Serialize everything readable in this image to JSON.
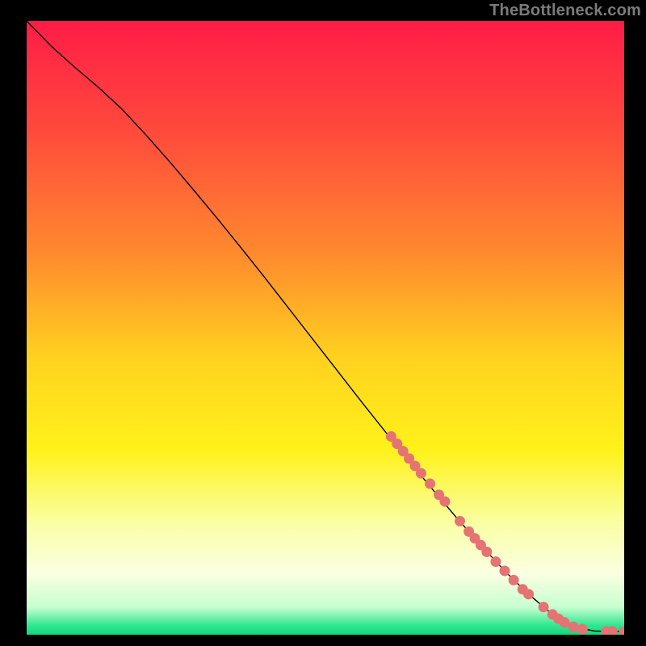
{
  "watermark": "TheBottleneck.com",
  "chart_data": {
    "type": "line",
    "title": "",
    "xlabel": "",
    "ylabel": "",
    "xlim": [
      0,
      100
    ],
    "ylim": [
      0,
      100
    ],
    "grid": false,
    "legend": false,
    "background_gradient": {
      "stops": [
        {
          "offset": 0.0,
          "color": "#ff1c47"
        },
        {
          "offset": 0.18,
          "color": "#ff4a3c"
        },
        {
          "offset": 0.38,
          "color": "#ff8a2e"
        },
        {
          "offset": 0.55,
          "color": "#ffd21f"
        },
        {
          "offset": 0.7,
          "color": "#fff21a"
        },
        {
          "offset": 0.82,
          "color": "#f9ffa6"
        },
        {
          "offset": 0.9,
          "color": "#fbffe2"
        },
        {
          "offset": 0.955,
          "color": "#c7ffd0"
        },
        {
          "offset": 0.985,
          "color": "#2fe78f"
        },
        {
          "offset": 1.0,
          "color": "#16d67e"
        }
      ]
    },
    "series": [
      {
        "name": "bottleneck-curve",
        "color": "#000000",
        "width": 1.4,
        "x": [
          0,
          4,
          8,
          12,
          16,
          20,
          24,
          28,
          32,
          36,
          40,
          44,
          48,
          52,
          56,
          60,
          64,
          68,
          72,
          76,
          80,
          84,
          88,
          91,
          93.5,
          95,
          96.5,
          98,
          99,
          100
        ],
        "y": [
          100,
          96,
          92.5,
          89.2,
          85.6,
          81.4,
          77.0,
          72.4,
          67.7,
          62.9,
          58.0,
          53.0,
          48.0,
          43.0,
          38.0,
          33.1,
          28.3,
          23.6,
          19.0,
          14.6,
          10.4,
          6.6,
          3.3,
          1.6,
          0.9,
          0.6,
          0.55,
          0.55,
          0.55,
          0.55
        ]
      }
    ],
    "markers": {
      "name": "highlight-points",
      "color": "#e57373",
      "radius": 6.5,
      "points": [
        {
          "x": 61.0,
          "y": 32.3
        },
        {
          "x": 62.0,
          "y": 31.1
        },
        {
          "x": 63.0,
          "y": 29.9
        },
        {
          "x": 64.0,
          "y": 28.7
        },
        {
          "x": 65.0,
          "y": 27.5
        },
        {
          "x": 66.0,
          "y": 26.3
        },
        {
          "x": 67.5,
          "y": 24.6
        },
        {
          "x": 69.0,
          "y": 22.8
        },
        {
          "x": 70.0,
          "y": 21.7
        },
        {
          "x": 72.5,
          "y": 18.5
        },
        {
          "x": 74.0,
          "y": 16.8
        },
        {
          "x": 75.0,
          "y": 15.7
        },
        {
          "x": 76.0,
          "y": 14.6
        },
        {
          "x": 77.0,
          "y": 13.5
        },
        {
          "x": 78.5,
          "y": 11.9
        },
        {
          "x": 80.0,
          "y": 10.4
        },
        {
          "x": 81.5,
          "y": 8.9
        },
        {
          "x": 83.0,
          "y": 7.4
        },
        {
          "x": 84.0,
          "y": 6.6
        },
        {
          "x": 86.5,
          "y": 4.5
        },
        {
          "x": 88.0,
          "y": 3.3
        },
        {
          "x": 89.0,
          "y": 2.6
        },
        {
          "x": 90.0,
          "y": 2.0
        },
        {
          "x": 91.5,
          "y": 1.3
        },
        {
          "x": 93.0,
          "y": 0.9
        },
        {
          "x": 97.0,
          "y": 0.55
        },
        {
          "x": 98.0,
          "y": 0.55
        },
        {
          "x": 100.0,
          "y": 0.55
        }
      ]
    }
  }
}
